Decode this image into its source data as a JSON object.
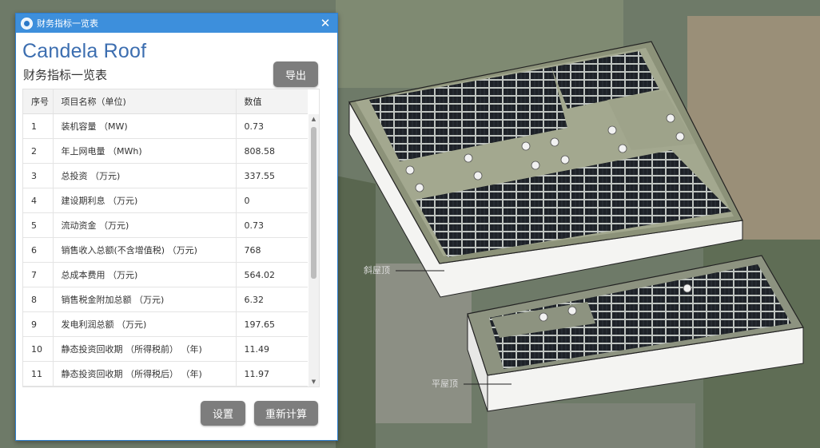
{
  "window": {
    "title": "财务指标一览表",
    "close_glyph": "✕"
  },
  "brand": "Candela Roof",
  "subtitle": "财务指标一览表",
  "buttons": {
    "export": "导出",
    "settings": "设置",
    "recalculate": "重新计算"
  },
  "table": {
    "headers": [
      "序号",
      "项目名称（单位)",
      "数值"
    ],
    "rows": [
      [
        "1",
        "装机容量 （MW)",
        "0.73"
      ],
      [
        "2",
        "年上网电量 （MWh)",
        "808.58"
      ],
      [
        "3",
        "总投资 （万元)",
        "337.55"
      ],
      [
        "4",
        "建设期利息 （万元)",
        "0"
      ],
      [
        "5",
        "流动资金 （万元)",
        "0.73"
      ],
      [
        "6",
        "销售收入总额(不含增值税) （万元)",
        "768"
      ],
      [
        "7",
        "总成本费用 （万元)",
        "564.02"
      ],
      [
        "8",
        "销售税金附加总额 （万元)",
        "6.32"
      ],
      [
        "9",
        "发电利润总额 （万元)",
        "197.65"
      ],
      [
        "10",
        "静态投资回收期 （所得税前） （年)",
        "11.49"
      ],
      [
        "11",
        "静态投资回收期 （所得税后） （年)",
        "11.97"
      ]
    ]
  },
  "scene_labels": {
    "upper_roof": "斜屋顶",
    "lower_roof": "平屋顶"
  },
  "icons": {
    "app": "app-globe-icon",
    "close": "close-icon"
  },
  "colors": {
    "titlebar": "#3d8fdc",
    "brand": "#3c6eb0",
    "button": "#7d7d7d"
  }
}
